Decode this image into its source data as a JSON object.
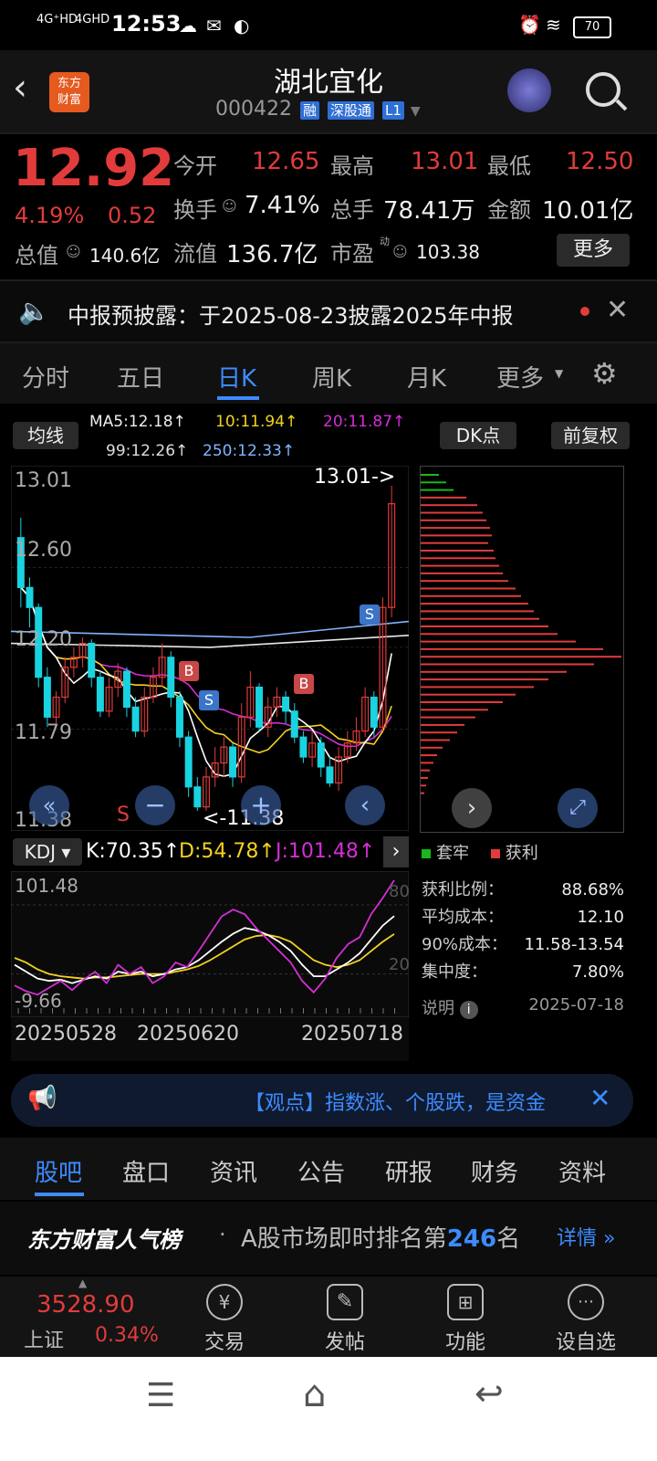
{
  "status": {
    "network1": "4G⁺HD",
    "network2": "4GHD",
    "time": "12:53",
    "battery": "70"
  },
  "header": {
    "title": "湖北宜化",
    "code": "000422",
    "badges": [
      "融",
      "深股通",
      "L1"
    ],
    "logo_text": "东方\n财富"
  },
  "quote": {
    "price": "12.92",
    "change_pct": "4.19%",
    "change": "0.52",
    "open_label": "今开",
    "open": "12.65",
    "high_label": "最高",
    "high": "13.01",
    "low_label": "最低",
    "low": "12.50",
    "turnover_label": "换手",
    "turnover": "7.41%",
    "volume_label": "总手",
    "volume": "78.41万",
    "amount_label": "金额",
    "amount": "10.01亿",
    "mktcap_label": "总值",
    "mktcap": "140.6亿",
    "float_label": "流值",
    "float": "136.7亿",
    "pe_label": "市盈",
    "pe_super": "动",
    "pe": "103.38",
    "more": "更多"
  },
  "notice": {
    "text": "中报预披露：于2025-08-23披露2025年中报"
  },
  "chart_tabs": [
    "分时",
    "五日",
    "日K",
    "周K",
    "月K",
    "更多"
  ],
  "indicator_bar": {
    "selector": "均线",
    "ma5": "MA5:12.18↑",
    "ma10": "10:11.94↑",
    "ma20": "20:11.87↑",
    "ma99": "99:12.26↑",
    "ma250": "250:12.33↑",
    "dk": "DK点",
    "adjust": "前复权"
  },
  "colors": {
    "up": "#e23b3b",
    "down": "#19d3e0",
    "ma5": "#ffffff",
    "ma10": "#f3d21e",
    "ma20": "#d62ed6",
    "ma99": "#e8e8e8",
    "ma250": "#7fb6ff",
    "accent": "#3d8bff"
  },
  "chart_data": {
    "type": "candlestick",
    "y_labels": [
      "13.01",
      "12.60",
      "12.20",
      "11.79",
      "11.38"
    ],
    "high_marker": "13.01->",
    "low_marker": "<-11.38",
    "signals": [
      "B",
      "S",
      "B",
      "S"
    ],
    "s_label": "S",
    "candles": [
      [
        12.75,
        12.5,
        12.85,
        12.4
      ],
      [
        12.5,
        12.4,
        12.55,
        12.3
      ],
      [
        12.4,
        12.05,
        12.42,
        12.0
      ],
      [
        12.05,
        11.85,
        12.1,
        11.8
      ],
      [
        11.85,
        11.95,
        11.98,
        11.82
      ],
      [
        11.95,
        12.1,
        12.15,
        11.92
      ],
      [
        12.1,
        12.15,
        12.2,
        12.05
      ],
      [
        12.15,
        12.22,
        12.25,
        12.1
      ],
      [
        12.22,
        12.05,
        12.24,
        12.0
      ],
      [
        12.05,
        11.88,
        12.08,
        11.85
      ],
      [
        11.88,
        12.0,
        12.05,
        11.85
      ],
      [
        12.0,
        12.08,
        12.12,
        11.95
      ],
      [
        12.08,
        11.9,
        12.1,
        11.85
      ],
      [
        11.9,
        11.78,
        11.95,
        11.75
      ],
      [
        11.78,
        11.95,
        12.0,
        11.75
      ],
      [
        11.95,
        12.05,
        12.1,
        11.92
      ],
      [
        12.05,
        12.15,
        12.22,
        12.0
      ],
      [
        12.15,
        11.95,
        12.18,
        11.9
      ],
      [
        11.95,
        11.75,
        11.98,
        11.7
      ],
      [
        11.75,
        11.5,
        11.78,
        11.45
      ],
      [
        11.5,
        11.4,
        11.55,
        11.38
      ],
      [
        11.4,
        11.55,
        11.6,
        11.38
      ],
      [
        11.55,
        11.62,
        11.7,
        11.5
      ],
      [
        11.62,
        11.7,
        11.75,
        11.55
      ],
      [
        11.7,
        11.55,
        11.72,
        11.5
      ],
      [
        11.55,
        11.85,
        11.92,
        11.52
      ],
      [
        11.85,
        12.0,
        12.08,
        11.8
      ],
      [
        12.0,
        11.8,
        12.02,
        11.78
      ],
      [
        11.8,
        11.9,
        11.95,
        11.75
      ],
      [
        11.9,
        11.95,
        12.0,
        11.85
      ],
      [
        11.95,
        11.88,
        11.98,
        11.82
      ],
      [
        11.88,
        11.75,
        11.92,
        11.72
      ],
      [
        11.75,
        11.65,
        11.78,
        11.62
      ],
      [
        11.65,
        11.72,
        11.78,
        11.6
      ],
      [
        11.72,
        11.6,
        11.75,
        11.55
      ],
      [
        11.6,
        11.52,
        11.65,
        11.5
      ],
      [
        11.52,
        11.65,
        11.7,
        11.48
      ],
      [
        11.65,
        11.72,
        11.78,
        11.62
      ],
      [
        11.72,
        11.78,
        11.85,
        11.68
      ],
      [
        11.78,
        11.95,
        12.0,
        11.75
      ],
      [
        11.95,
        11.8,
        11.98,
        11.75
      ],
      [
        11.8,
        12.4,
        12.45,
        11.78
      ],
      [
        12.4,
        12.92,
        13.01,
        12.35
      ]
    ],
    "kdj_y_labels": [
      "101.48",
      "-9.66"
    ],
    "kdj_levels": [
      "80",
      "20"
    ],
    "x_labels": [
      "20250528",
      "20250620",
      "20250718"
    ]
  },
  "kdj": {
    "selector": "KDJ",
    "k": "K:70.35↑",
    "d": "D:54.78↑",
    "j": "J:101.48↑"
  },
  "chip": {
    "legend_trapped": "套牢",
    "legend_profit": "获利",
    "rows": [
      {
        "label": "获利比例：",
        "value": "88.68%"
      },
      {
        "label": "平均成本：",
        "value": "12.10"
      },
      {
        "label": "90%成本：",
        "value": "11.58-13.54"
      },
      {
        "label": "集中度：",
        "value": "7.80%"
      }
    ],
    "note_label": "说明",
    "date": "2025-07-18"
  },
  "ticker": {
    "text": "【观点】指数涨、个股跌，是资金"
  },
  "bottom_tabs": [
    "股吧",
    "盘口",
    "资讯",
    "公告",
    "研报",
    "财务",
    "资料"
  ],
  "popularity": {
    "brand": "东方财富人气榜",
    "text_pre": "A股市场即时排名第",
    "rank": "246",
    "text_post": "名",
    "detail": "详情"
  },
  "nav": {
    "index_value": "3528.90",
    "index_name": "上证",
    "index_change": "0.34%",
    "items": [
      "交易",
      "发帖",
      "功能",
      "设自选"
    ]
  }
}
